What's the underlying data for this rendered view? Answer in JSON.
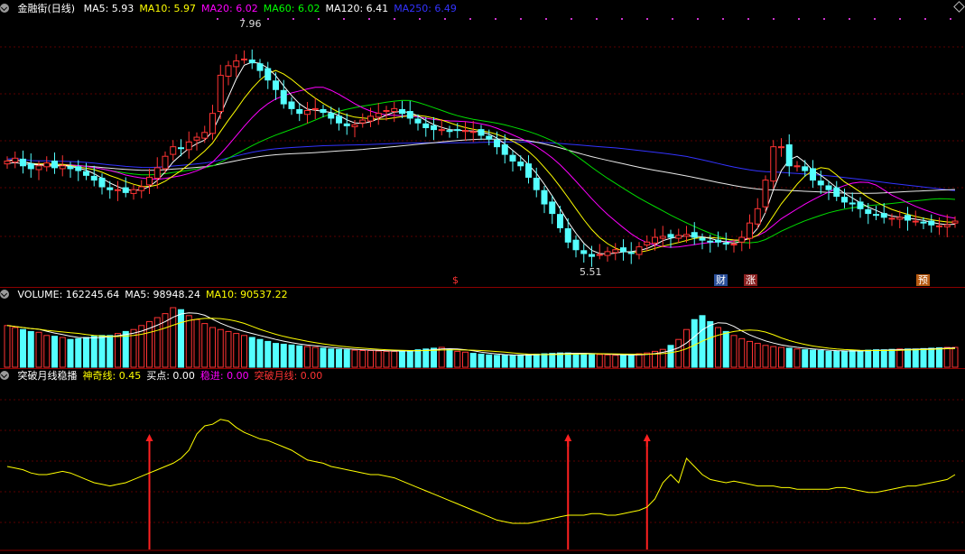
{
  "main": {
    "title": "金融街(日线)",
    "ma_labels": [
      {
        "text": "MA5: 5.93",
        "color": "#ffffff"
      },
      {
        "text": "MA10: 5.97",
        "color": "#ffff00"
      },
      {
        "text": "MA20: 6.02",
        "color": "#ff00ff"
      },
      {
        "text": "MA60: 6.02",
        "color": "#00ff00"
      },
      {
        "text": "MA120: 6.41",
        "color": "#ffffff"
      },
      {
        "text": "MA250: 6.49",
        "color": "#3333ff"
      }
    ],
    "high_label": "7.96",
    "low_label": "5.51",
    "markers": {
      "dollar": "$",
      "cai": "财",
      "zhang": "涨",
      "yu": "预"
    }
  },
  "volume": {
    "labels": [
      {
        "text": "VOLUME: 162245.64",
        "color": "#ffffff"
      },
      {
        "text": "MA5: 98948.24",
        "color": "#ffffff"
      },
      {
        "text": "MA10: 90537.22",
        "color": "#ffff00"
      }
    ]
  },
  "indicator": {
    "labels": [
      {
        "text": "突破月线稳播",
        "color": "#ffffff"
      },
      {
        "text": "神奇线: 0.45",
        "color": "#ffff00"
      },
      {
        "text": "买点: 0.00",
        "color": "#ffffff"
      },
      {
        "text": "稳进: 0.00",
        "color": "#ff00ff"
      },
      {
        "text": "突破月线: 0.00",
        "color": "#ff3333"
      }
    ]
  },
  "chart_data": {
    "type": "line",
    "close": [
      6.55,
      6.58,
      6.5,
      6.47,
      6.5,
      6.53,
      6.48,
      6.5,
      6.47,
      6.45,
      6.4,
      6.35,
      6.28,
      6.25,
      6.25,
      6.22,
      6.25,
      6.28,
      6.38,
      6.48,
      6.6,
      6.7,
      6.68,
      6.75,
      6.8,
      6.85,
      7.05,
      7.45,
      7.55,
      7.6,
      7.62,
      7.58,
      7.5,
      7.4,
      7.3,
      7.15,
      7.1,
      7.05,
      7.08,
      7.1,
      7.06,
      7.0,
      6.95,
      6.92,
      6.93,
      6.98,
      7.02,
      7.05,
      7.08,
      7.1,
      7.05,
      7.0,
      6.95,
      6.9,
      6.88,
      6.88,
      6.86,
      6.87,
      6.87,
      6.86,
      6.82,
      6.78,
      6.7,
      6.62,
      6.55,
      6.5,
      6.38,
      6.25,
      6.1,
      6.0,
      5.85,
      5.7,
      5.62,
      5.58,
      5.55,
      5.57,
      5.6,
      5.62,
      5.6,
      5.58,
      5.65,
      5.7,
      5.75,
      5.76,
      5.75,
      5.77,
      5.78,
      5.75,
      5.72,
      5.7,
      5.7,
      5.68,
      5.68,
      5.75,
      5.9,
      6.05,
      6.35,
      6.7,
      6.7,
      6.5,
      6.5,
      6.45,
      6.35,
      6.3,
      6.25,
      6.18,
      6.12,
      6.1,
      6.05,
      6.0,
      5.98,
      5.96,
      5.95,
      5.96,
      5.93,
      5.92,
      5.9,
      5.88,
      5.87,
      5.88,
      5.92
    ],
    "volume": [
      105,
      100,
      95,
      90,
      88,
      80,
      78,
      75,
      70,
      72,
      75,
      78,
      80,
      80,
      85,
      90,
      95,
      105,
      115,
      125,
      135,
      150,
      145,
      130,
      120,
      110,
      100,
      95,
      90,
      85,
      80,
      75,
      70,
      65,
      60,
      58,
      56,
      54,
      52,
      50,
      48,
      46,
      45,
      44,
      43,
      42,
      42,
      41,
      40,
      40,
      41,
      42,
      44,
      46,
      48,
      50,
      45,
      40,
      38,
      35,
      33,
      31,
      30,
      30,
      30,
      31,
      32,
      33,
      34,
      35,
      36,
      36,
      35,
      34,
      33,
      32,
      31,
      30,
      30,
      32,
      34,
      36,
      40,
      45,
      55,
      70,
      95,
      120,
      130,
      115,
      100,
      90,
      80,
      72,
      65,
      60,
      55,
      52,
      50,
      48,
      46,
      44,
      43,
      42,
      40,
      40,
      41,
      42,
      42,
      43,
      44,
      44,
      45,
      46,
      46,
      46,
      47,
      48,
      49,
      50,
      50
    ],
    "magic_line": [
      0.5,
      0.49,
      0.48,
      0.46,
      0.45,
      0.45,
      0.46,
      0.47,
      0.46,
      0.44,
      0.42,
      0.4,
      0.39,
      0.38,
      0.39,
      0.4,
      0.42,
      0.44,
      0.46,
      0.48,
      0.5,
      0.52,
      0.55,
      0.6,
      0.7,
      0.75,
      0.76,
      0.79,
      0.78,
      0.74,
      0.71,
      0.69,
      0.67,
      0.66,
      0.64,
      0.62,
      0.6,
      0.57,
      0.54,
      0.53,
      0.52,
      0.5,
      0.49,
      0.48,
      0.47,
      0.46,
      0.45,
      0.45,
      0.44,
      0.43,
      0.41,
      0.39,
      0.37,
      0.35,
      0.33,
      0.31,
      0.29,
      0.27,
      0.25,
      0.23,
      0.21,
      0.19,
      0.17,
      0.16,
      0.15,
      0.15,
      0.15,
      0.16,
      0.17,
      0.18,
      0.19,
      0.2,
      0.2,
      0.2,
      0.21,
      0.21,
      0.2,
      0.2,
      0.21,
      0.22,
      0.23,
      0.25,
      0.3,
      0.4,
      0.45,
      0.4,
      0.55,
      0.5,
      0.45,
      0.42,
      0.41,
      0.4,
      0.41,
      0.4,
      0.39,
      0.38,
      0.38,
      0.38,
      0.37,
      0.37,
      0.36,
      0.36,
      0.36,
      0.36,
      0.36,
      0.37,
      0.37,
      0.36,
      0.35,
      0.34,
      0.34,
      0.35,
      0.36,
      0.37,
      0.38,
      0.38,
      0.39,
      0.4,
      0.41,
      0.42,
      0.45
    ],
    "signals": [
      18,
      71,
      81
    ],
    "y_range_price": [
      5.4,
      8.05
    ],
    "legend": "top-left"
  }
}
